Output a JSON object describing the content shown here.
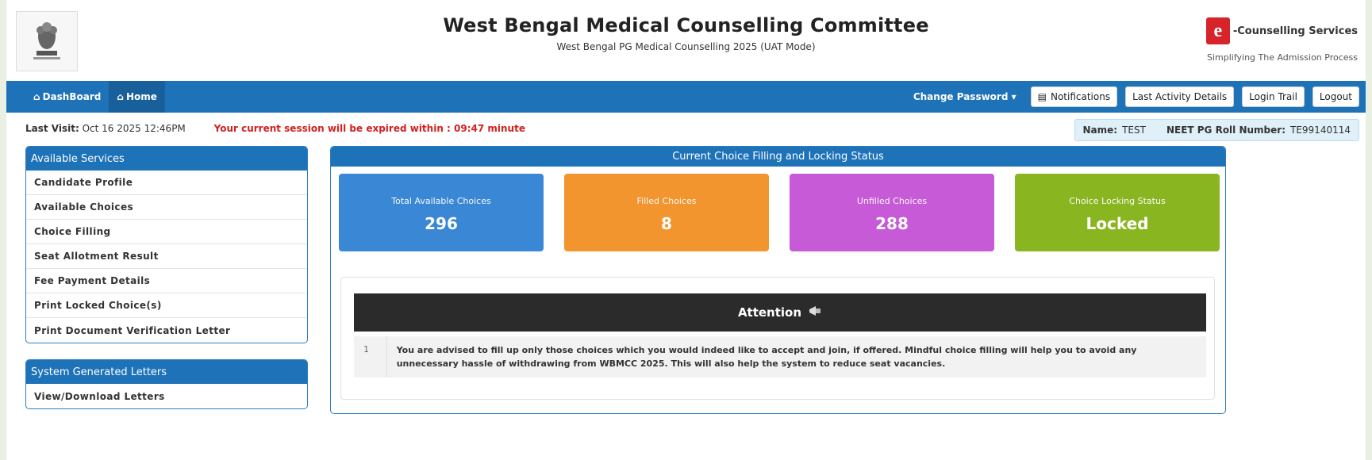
{
  "header": {
    "title": "West Bengal Medical Counselling Committee",
    "subtitle": "West Bengal PG Medical Counselling 2025 (UAT Mode)",
    "brand_name": "-Counselling Services",
    "brand_tagline": "Simplifying The Admission Process",
    "brand_logo_letter": "e"
  },
  "nav": {
    "dashboard": "DashBoard",
    "home": "Home",
    "change_password": "Change Password ▾",
    "notifications": "Notifications",
    "last_activity": "Last Activity Details",
    "login_trail": "Login Trail",
    "logout": "Logout"
  },
  "info": {
    "last_visit_label": "Last Visit:",
    "last_visit_value": "Oct 16 2025 12:46PM",
    "session_warning": "Your current session will be expired within : 09:47 minute",
    "name_label": "Name:",
    "name_value": "TEST",
    "roll_label": "NEET PG Roll Number:",
    "roll_value": "TE99140114"
  },
  "available_services": {
    "title": "Available Services",
    "items": [
      "Candidate Profile",
      "Available Choices",
      "Choice Filling",
      "Seat Allotment Result",
      "Fee Payment Details",
      "Print Locked Choice(s)",
      "Print Document Verification Letter"
    ]
  },
  "letters": {
    "title": "System Generated Letters",
    "items": [
      "View/Download Letters"
    ]
  },
  "status": {
    "title": "Current Choice Filling and Locking Status",
    "cards": [
      {
        "label": "Total Available Choices",
        "value": "296",
        "color": "#3a87d6"
      },
      {
        "label": "Filled Choices",
        "value": "8",
        "color": "#f2952f"
      },
      {
        "label": "Unfilled Choices",
        "value": "288",
        "color": "#c75ad6"
      },
      {
        "label": "Choice Locking Status",
        "value": "Locked",
        "color": "#89b521"
      }
    ]
  },
  "attention": {
    "title": "Attention",
    "row_number": "1",
    "row_text": "You are advised to fill up only those choices which you would indeed like to accept and join, if offered. Mindful choice filling will help you to avoid any unnecessary hassle of withdrawing from WBMCC 2025. This will also help the system to reduce seat vacancies."
  },
  "colors": {
    "primary": "#1e72b8",
    "warning_text": "#d42020",
    "attention_bg": "#2b2b2b"
  }
}
